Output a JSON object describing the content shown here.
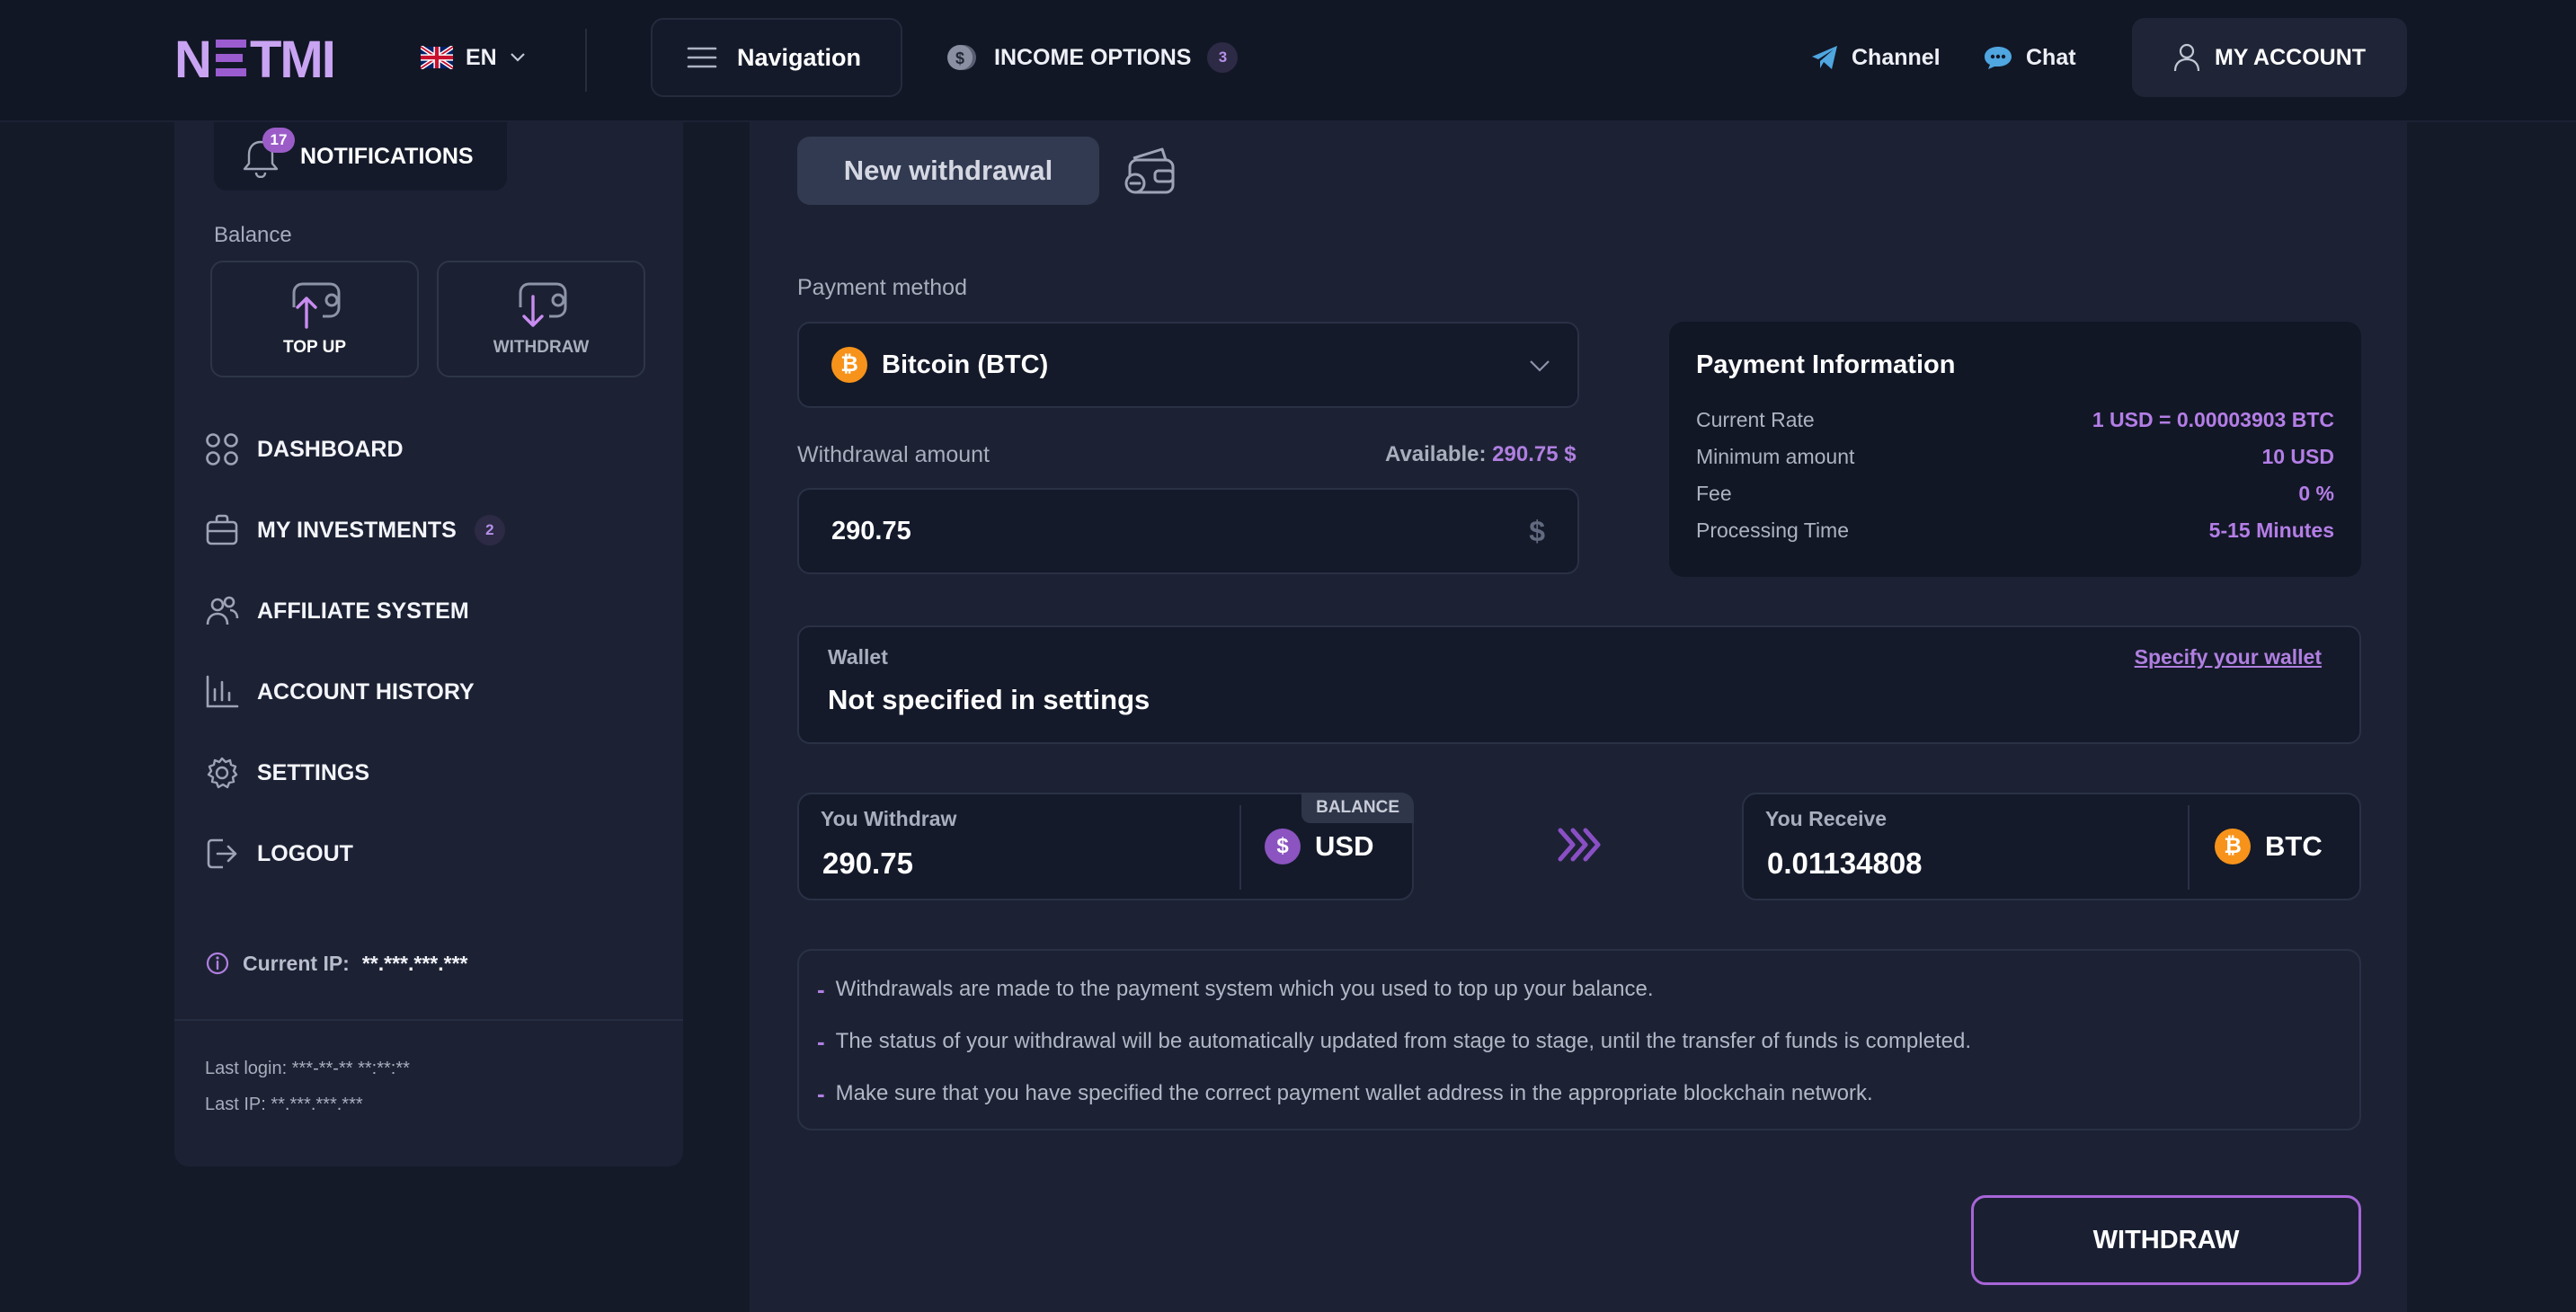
{
  "header": {
    "logo_text": "NETMI",
    "language": "EN",
    "navigation_label": "Navigation",
    "income_options_label": "INCOME OPTIONS",
    "income_options_count": "3",
    "channel_label": "Channel",
    "chat_label": "Chat",
    "account_label": "MY ACCOUNT"
  },
  "sidebar": {
    "notifications_label": "NOTIFICATIONS",
    "notifications_count": "17",
    "balance_label": "Balance",
    "top_up_label": "TOP UP",
    "withdraw_label": "WITHDRAW",
    "menu": [
      {
        "label": "DASHBOARD",
        "icon": "grid-icon"
      },
      {
        "label": "MY INVESTMENTS",
        "icon": "briefcase-icon",
        "badge": "2"
      },
      {
        "label": "AFFILIATE SYSTEM",
        "icon": "users-icon"
      },
      {
        "label": "ACCOUNT HISTORY",
        "icon": "bar-chart-icon"
      },
      {
        "label": "SETTINGS",
        "icon": "gear-icon"
      },
      {
        "label": "LOGOUT",
        "icon": "logout-icon"
      }
    ],
    "current_ip_label": "Current IP:",
    "current_ip_value": "**.***.***.***",
    "last_login": "Last login: ***-**-** **:**:**",
    "last_ip": "Last IP: **.***.***.***"
  },
  "main": {
    "tab_label": "New withdrawal",
    "payment_method_label": "Payment method",
    "payment_method_value": "Bitcoin (BTC)",
    "withdrawal_amount_label": "Withdrawal amount",
    "available_label": "Available:",
    "available_value": "290.75 $",
    "amount_value": "290.75",
    "amount_unit": "$",
    "payment_info": {
      "title": "Payment Information",
      "rows": [
        {
          "key": "Current Rate",
          "value": "1 USD = 0.00003903 BTC"
        },
        {
          "key": "Minimum amount",
          "value": "10 USD"
        },
        {
          "key": "Fee",
          "value": "0 %"
        },
        {
          "key": "Processing Time",
          "value": "5-15 Minutes"
        }
      ]
    },
    "wallet_label": "Wallet",
    "wallet_value": "Not specified in settings",
    "wallet_link": "Specify your wallet",
    "you_withdraw_label": "You Withdraw",
    "you_withdraw_value": "290.75",
    "withdraw_currency": "USD",
    "balance_tag": "BALANCE",
    "you_receive_label": "You Receive",
    "you_receive_value": "0.01134808",
    "receive_currency": "BTC",
    "notes": [
      "Withdrawals are made to the payment system which you used to top up your balance.",
      "The status of your withdrawal will be automatically updated from stage to stage, until the transfer of funds is completed.",
      "Make sure that you have specified the correct payment wallet address in the appropriate blockchain network."
    ],
    "withdraw_button": "WITHDRAW"
  },
  "colors": {
    "background": "#151a29",
    "panel": "#1c2234",
    "accent": "#b07fe0",
    "bitcoin": "#f7931a"
  }
}
